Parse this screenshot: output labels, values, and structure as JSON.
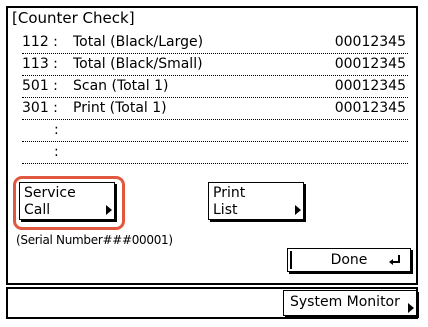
{
  "header": {
    "title": "[Counter Check]"
  },
  "counters": [
    {
      "code": "112 :",
      "label": "Total (Black/Large)",
      "value": "00012345"
    },
    {
      "code": "113 :",
      "label": "Total (Black/Small)",
      "value": "00012345"
    },
    {
      "code": "501 :",
      "label": "Scan (Total 1)",
      "value": "00012345"
    },
    {
      "code": "301 :",
      "label": "Print (Total 1)",
      "value": "00012345"
    },
    {
      "code": ":",
      "label": "",
      "value": ""
    },
    {
      "code": ":",
      "label": "",
      "value": ""
    }
  ],
  "buttons": {
    "service_call": {
      "line1": "Service",
      "line2": "Call"
    },
    "print_list": {
      "line1": "Print",
      "line2": "List"
    },
    "done": "Done",
    "system_monitor": "System Monitor"
  },
  "serial": "(Serial Number###00001)",
  "colors": {
    "highlight": "#e2583e"
  }
}
